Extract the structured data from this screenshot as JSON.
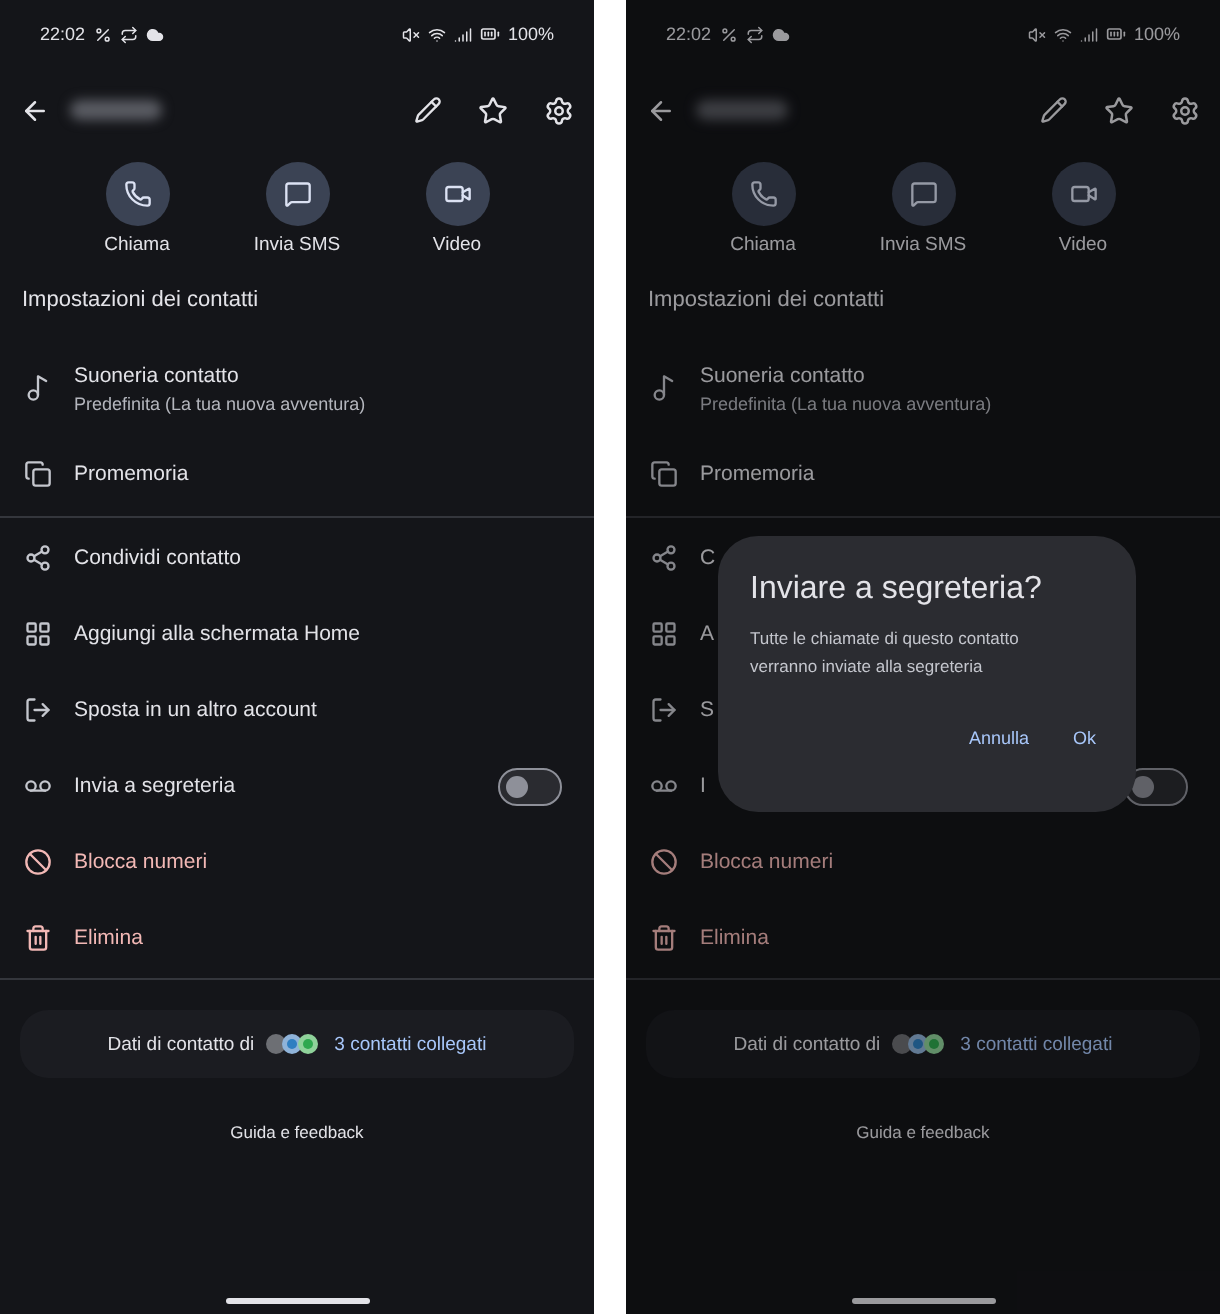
{
  "screens": [
    {
      "status_bar": {
        "time": "22:02",
        "battery": "100%"
      },
      "actions": [
        {
          "label": "Chiama"
        },
        {
          "label": "Invia SMS"
        },
        {
          "label": "Video"
        }
      ],
      "section_title": "Impostazioni dei contatti",
      "groups": [
        [
          {
            "kind": "two-line",
            "title": "Suoneria contatto",
            "subtitle": "Predefinita (La tua nuova avventura)"
          },
          {
            "kind": "plain",
            "title": "Promemoria"
          }
        ],
        [
          {
            "kind": "plain",
            "title": "Condividi contatto"
          },
          {
            "kind": "plain",
            "title": "Aggiungi alla schermata Home"
          },
          {
            "kind": "plain",
            "title": "Sposta in un altro account"
          },
          {
            "kind": "toggle",
            "title": "Invia a segreteria",
            "on": false
          },
          {
            "kind": "danger",
            "title": "Blocca numeri"
          },
          {
            "kind": "danger",
            "title": "Elimina"
          }
        ]
      ],
      "linked": {
        "prefix": "Dati di contatto di",
        "link": "3 contatti collegati"
      },
      "footer": "Guida e feedback"
    },
    {
      "status_bar": {
        "time": "22:02",
        "battery": "100%"
      },
      "actions": [
        {
          "label": "Chiama"
        },
        {
          "label": "Invia SMS"
        },
        {
          "label": "Video"
        }
      ],
      "section_title": "Impostazioni dei contatti",
      "groups": [
        [
          {
            "kind": "two-line",
            "title": "Suoneria contatto",
            "subtitle": "Predefinita (La tua nuova avventura)"
          },
          {
            "kind": "plain",
            "title": "Promemoria"
          }
        ],
        [
          {
            "kind": "plain",
            "title": "C"
          },
          {
            "kind": "plain",
            "title": "A"
          },
          {
            "kind": "plain",
            "title": "S"
          },
          {
            "kind": "toggle",
            "title": "I",
            "on": false
          },
          {
            "kind": "danger",
            "title": "Blocca numeri"
          },
          {
            "kind": "danger",
            "title": "Elimina"
          }
        ]
      ],
      "linked": {
        "prefix": "Dati di contatto di",
        "link": "3 contatti collegati"
      },
      "footer": "Guida e feedback",
      "dialog": {
        "title": "Inviare a segreteria?",
        "body": "Tutte le chiamate di questo contatto verranno inviate alla segreteria",
        "buttons": [
          "Annulla",
          "Ok"
        ]
      }
    }
  ]
}
